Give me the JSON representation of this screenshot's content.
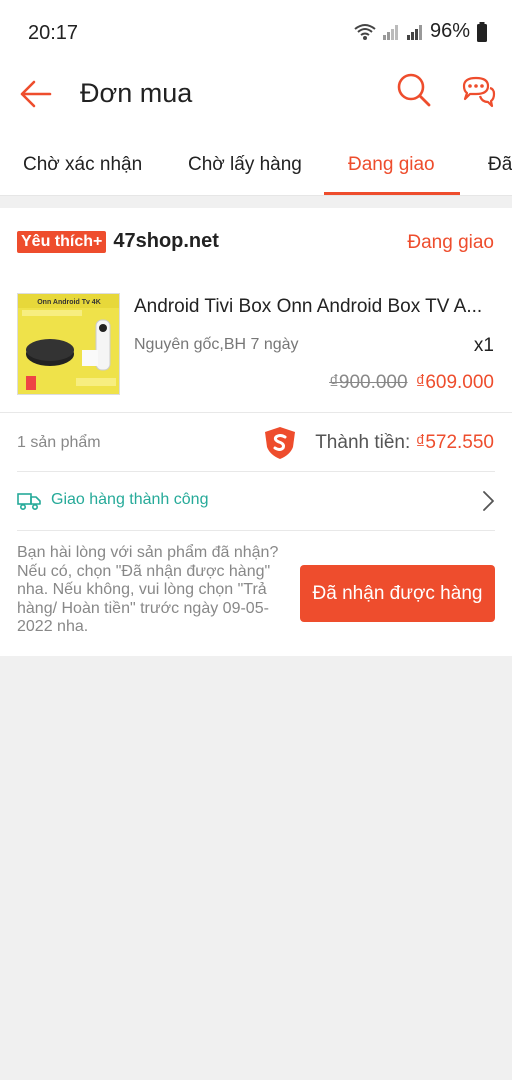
{
  "status_bar": {
    "time": "20:17",
    "battery": "96%"
  },
  "header": {
    "title": "Đơn mua",
    "back_icon": "arrow-left-icon",
    "search_icon": "search-icon",
    "chat_icon": "chat-icon"
  },
  "tabs": [
    {
      "label": "Chờ xác nhận"
    },
    {
      "label": "Chờ lấy hàng"
    },
    {
      "label": "Đang giao",
      "active": true
    },
    {
      "label": "Đã"
    }
  ],
  "order": {
    "badge": "Yêu thích+",
    "shop_name": "47shop.net",
    "status": "Đang giao",
    "product": {
      "name": "Android Tivi Box Onn Android Box TV A...",
      "thumb_text": "Onn Android Tv 4K",
      "variation": "Nguyên gốc,BH 7 ngày",
      "quantity": "x1",
      "old_price": "₫900.000",
      "new_price": "₫609.000"
    },
    "item_count": "1 sản phẩm",
    "total_label": "Thành tiền:",
    "total_value": "₫572.550",
    "shipping_status": "Giao hàng thành công",
    "note": "Bạn hài lòng với sản phẩm đã nhận? Nếu có, chọn \"Đã nhận được hàng\" nha. Nếu không, vui lòng chọn \"Trả hàng/ Hoàn tiền\" trước ngày 09-05-2022 nha.",
    "received_button": "Đã nhận được hàng"
  },
  "colors": {
    "accent": "#ee4d2d",
    "shipping": "#26aa99",
    "background": "#f0f0f0"
  }
}
